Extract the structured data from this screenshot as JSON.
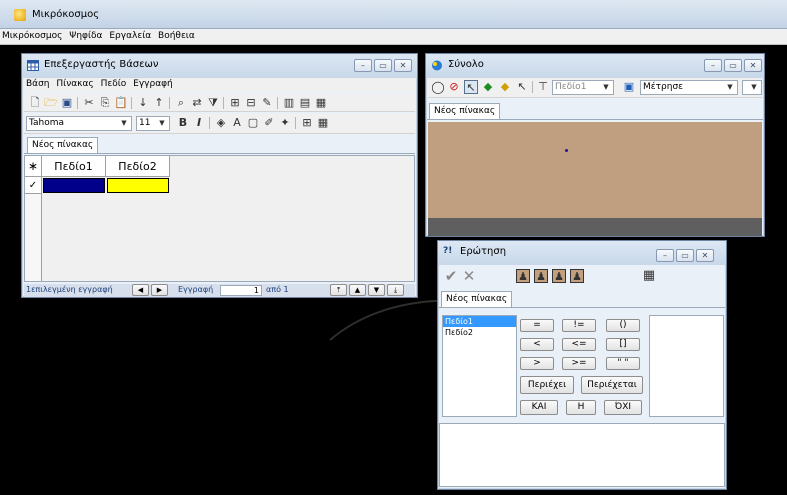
{
  "app": {
    "title": "Μικρόκοσμος"
  },
  "main_menu": [
    "Μικρόκοσμος",
    "Ψηφίδα",
    "Εργαλεία",
    "Βοήθεια"
  ],
  "db_editor": {
    "title": "Επεξεργαστής Βάσεων",
    "menu": [
      "Βάση",
      "Πίνακας",
      "Πεδίο",
      "Εγγραφή"
    ],
    "font_name": "Tahoma",
    "font_size": "11",
    "tab": "Νέος πίνακας",
    "columns": [
      "Πεδίο1",
      "Πεδίο2"
    ],
    "new_row_marker": "∗",
    "current_row_marker": "✓",
    "row_colors": [
      "#00008b",
      "#ffff00"
    ],
    "status": {
      "selected": "1επιλεγμένη εγγραφή",
      "record_label": "Εγγραφή",
      "record_value": "1",
      "of_label": "από 1"
    }
  },
  "synolo": {
    "title": "Σύνολο",
    "field_combo": "Πεδίο1",
    "measure_combo": "Μέτρησε",
    "tab": "Νέος πίνακας",
    "canvas_color": "#bf9f7f",
    "point_color": "#1a1a8c"
  },
  "query": {
    "title": "Ερώτηση",
    "tab": "Νέος πίνακας",
    "fields": [
      "Πεδίο1",
      "Πεδίο2"
    ],
    "op_buttons": [
      "=",
      "!=",
      "()",
      "<",
      "<=",
      "[]",
      ">",
      ">=",
      "\" \""
    ],
    "contains": "Περιέχει",
    "contained": "Περιέχεται",
    "logic": [
      "ΚΑΙ",
      "Η",
      "ΌΧΙ"
    ]
  }
}
